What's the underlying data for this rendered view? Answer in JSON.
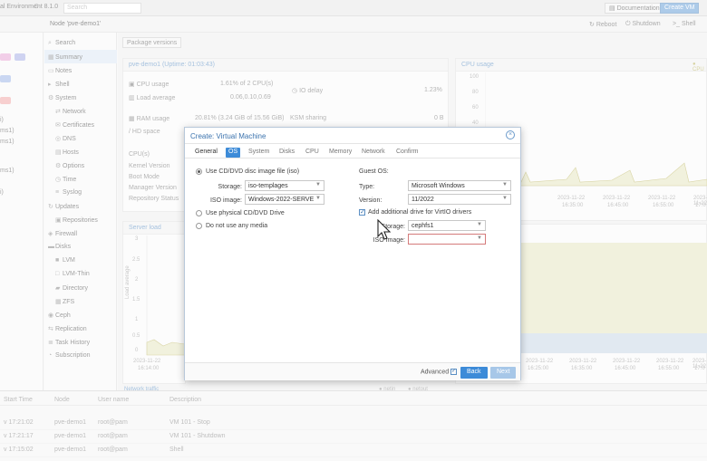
{
  "topbar": {
    "title": "al Environment 8.1.0",
    "search_placeholder": "Search",
    "documentation": "Documentation",
    "create_vm": "Create VM"
  },
  "subbar": {
    "node": "Node 'pve-demo1'",
    "reboot": "Reboot",
    "shutdown": "Shutdown",
    "shell": "Shell"
  },
  "tree": {
    "items": [
      "i)",
      "ms1)",
      "",
      "ms1)",
      "",
      "i)"
    ]
  },
  "nav": {
    "items": [
      {
        "label": "Search",
        "icon": "search-icon"
      },
      {
        "label": "Summary",
        "icon": "summary-icon"
      },
      {
        "label": "Notes",
        "icon": "notes-icon"
      },
      {
        "label": "Shell",
        "icon": "terminal-icon"
      },
      {
        "label": "System",
        "icon": "gear-icon"
      },
      {
        "label": "Network",
        "icon": "network-icon"
      },
      {
        "label": "Certificates",
        "icon": "certificate-icon"
      },
      {
        "label": "DNS",
        "icon": "globe-icon"
      },
      {
        "label": "Hosts",
        "icon": "hosts-icon"
      },
      {
        "label": "Options",
        "icon": "options-icon"
      },
      {
        "label": "Time",
        "icon": "clock-icon"
      },
      {
        "label": "Syslog",
        "icon": "list-icon"
      },
      {
        "label": "Updates",
        "icon": "refresh-icon"
      },
      {
        "label": "Repositories",
        "icon": "repository-icon"
      },
      {
        "label": "Firewall",
        "icon": "shield-icon"
      },
      {
        "label": "Disks",
        "icon": "disk-icon"
      },
      {
        "label": "LVM",
        "icon": "lvm-icon"
      },
      {
        "label": "LVM-Thin",
        "icon": "lvm-thin-icon"
      },
      {
        "label": "Directory",
        "icon": "folder-icon"
      },
      {
        "label": "ZFS",
        "icon": "zfs-icon"
      },
      {
        "label": "Ceph",
        "icon": "ceph-icon"
      },
      {
        "label": "Replication",
        "icon": "replication-icon"
      },
      {
        "label": "Task History",
        "icon": "history-icon"
      },
      {
        "label": "Subscription",
        "icon": "subscription-icon"
      }
    ]
  },
  "content": {
    "package_versions": "Package versions",
    "node_title": "pve-demo1 (Uptime: 01:03:43)",
    "cpu_usage_label": "CPU usage",
    "cpu_usage_value": "1.61% of 2 CPU(s)",
    "io_delay_label": "IO delay",
    "io_delay_value": "1.23%",
    "load_avg_label": "Load average",
    "load_avg_value": "0.06,0.10,0.69",
    "ram_label": "RAM usage",
    "ram_value": "20.81% (3.24 GiB of 15.56 GiB)",
    "ksm_label": "KSM sharing",
    "ksm_value": "0 B",
    "hd_label": "/ HD space",
    "cpus_label": "CPU(s)",
    "kernel_label": "Kernel Version",
    "boot_label": "Boot Mode",
    "manager_label": "Manager Version",
    "repo_label": "Repository Status",
    "cpu_chart_title": "CPU usage",
    "cpu_legend": "CPU",
    "cpu_ticks": [
      "100",
      "80",
      "60",
      "40",
      "20",
      "0"
    ],
    "server_load_title": "Server load",
    "server_load_ticks": [
      "3",
      "2.5",
      "2",
      "1.5",
      "1",
      "0.5",
      "0"
    ],
    "load_axis_label": "Load average",
    "time_ticks": [
      "2023-11-22",
      "2023-11-22",
      "2023-11-22",
      "2023-11-22",
      "2023-11-22",
      "2023-11-22"
    ],
    "time_ticks2": [
      "16:25:00",
      "16:35:00",
      "16:45:00",
      "16:55:00",
      "17:0"
    ],
    "left_time": [
      "2023-11-22",
      "16:14:00"
    ],
    "network_title": "Network traffic",
    "net_legend_in": "netin",
    "net_legend_out": "netout"
  },
  "tasklog": {
    "headers": [
      "Start Time",
      "Node",
      "User name",
      "Description"
    ],
    "rows": [
      {
        "time": "v 17:21:02",
        "node": "pve-demo1",
        "user": "root@pam",
        "desc": "VM 101 - Stop"
      },
      {
        "time": "v 17:21:17",
        "node": "pve-demo1",
        "user": "root@pam",
        "desc": "VM 101 - Shutdown"
      },
      {
        "time": "v 17:15:02",
        "node": "pve-demo1",
        "user": "root@pam",
        "desc": "Shell"
      }
    ]
  },
  "modal": {
    "title": "Create: Virtual Machine",
    "tabs": [
      "General",
      "OS",
      "System",
      "Disks",
      "CPU",
      "Memory",
      "Network",
      "Confirm"
    ],
    "active_tab": "OS",
    "use_cd_label": "Use CD/DVD disc image file (iso)",
    "storage_label": "Storage:",
    "storage_value": "iso-templages",
    "iso_label": "ISO image:",
    "iso_value": "Windows-2022-SERVE",
    "physical_label": "Use physical CD/DVD Drive",
    "nomedia_label": "Do not use any media",
    "guest_os_label": "Guest OS:",
    "type_label": "Type:",
    "type_value": "Microsoft Windows",
    "version_label": "Version:",
    "version_value": "11/2022",
    "virtio_label": "Add additional drive for VirtIO drivers",
    "storage2_label": "Storage:",
    "storage2_value": "cephfs1",
    "iso2_label": "ISO Image:",
    "iso2_value": "",
    "advanced_label": "Advanced",
    "back_label": "Back",
    "next_label": "Next"
  },
  "colors": {
    "accent": "#3d8bd8",
    "title_blue": "#3a72ad",
    "error_border": "#d57b7b",
    "chart_fill": "#e6e6c2"
  }
}
